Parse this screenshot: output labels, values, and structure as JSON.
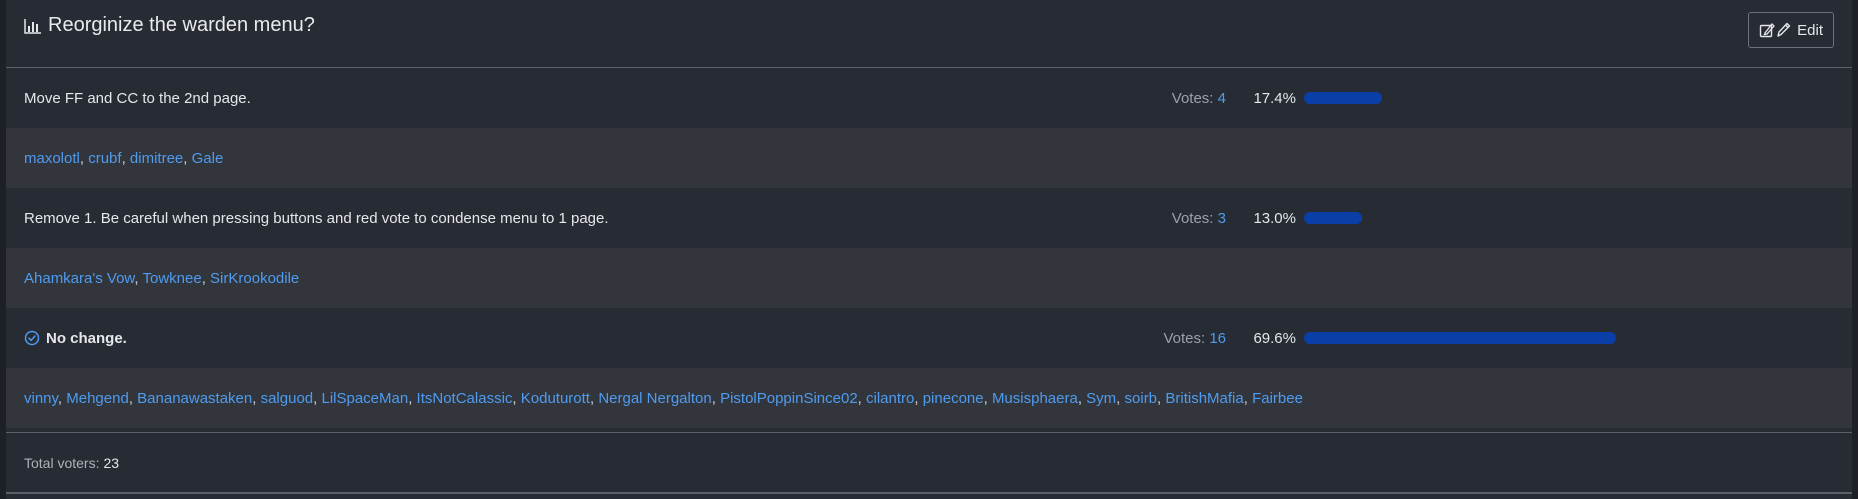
{
  "poll": {
    "title": "Reorginize the warden menu?",
    "edit_label": "Edit",
    "votes_label": "Votes:",
    "options": [
      {
        "text": "Move FF and CC to the 2nd page.",
        "votes": "4",
        "percent": "17.4%",
        "fraction": 0.174,
        "selected": false,
        "voters": [
          "maxolotl",
          "crubf",
          "dimitree",
          "Gale"
        ]
      },
      {
        "text": "Remove 1. Be careful when pressing buttons and red vote to condense menu to 1 page.",
        "votes": "3",
        "percent": "13.0%",
        "fraction": 0.13,
        "selected": false,
        "voters": [
          "Ahamkara's Vow",
          "Towknee",
          "SirKrookodile"
        ]
      },
      {
        "text": "No change.",
        "votes": "16",
        "percent": "69.6%",
        "fraction": 0.696,
        "selected": true,
        "voters": [
          "vinny",
          "Mehgend",
          "Bananawastaken",
          "salguod",
          "LilSpaceMan",
          "ItsNotCalassic",
          "Koduturott",
          "Nergal Nergalton",
          "PistolPoppinSince02",
          "cilantro",
          "pinecone",
          "Musisphaera",
          "Sym",
          "soirb",
          "BritishMafia",
          "Fairbee"
        ]
      }
    ],
    "total_label": "Total voters:",
    "total_count": "23"
  },
  "colors": {
    "accent": "#4f9bf0",
    "bar": "#0b3fa8",
    "background": "#272b33",
    "voter_row": "#32363c"
  },
  "icons": {
    "title": "bar-chart-icon",
    "edit": "edit-pen-icon",
    "selected": "check-circle-icon"
  }
}
